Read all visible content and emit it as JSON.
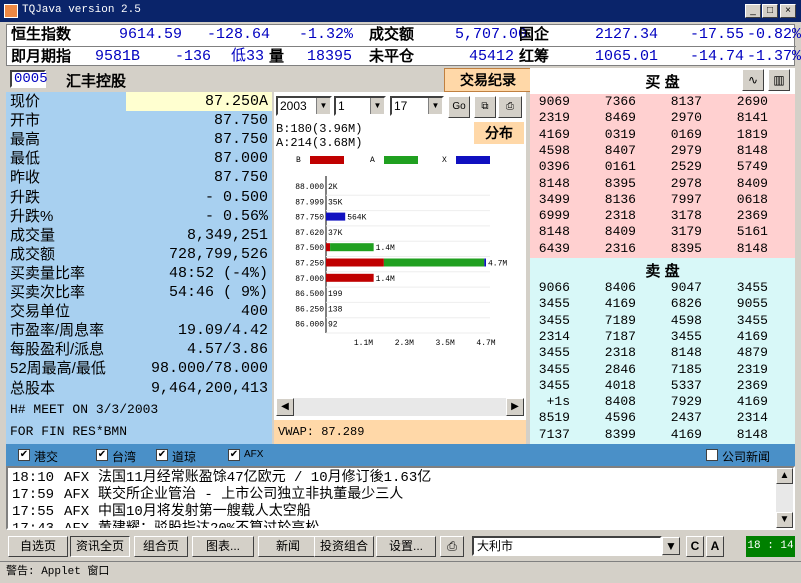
{
  "window": {
    "title": "TQJava version 2.5",
    "min": "_",
    "max": "□",
    "close": "×"
  },
  "indices": [
    {
      "name": "恒生指数",
      "v1": "9614.59",
      "v2": "-128.64",
      "v3": "-1.32%",
      "name2": "成交额",
      "v4": "5,707.00",
      "name3": "国企",
      "v5": "2127.34",
      "v6": "-17.55",
      "v7": "-0.82%"
    },
    {
      "name": "即月期指",
      "v1": "9581B",
      "v2": "-136",
      "v3": "低33",
      "name2": "量",
      "v3b": "18395",
      "name2b": "未平仓",
      "v4": "45412",
      "name3": "红筹",
      "v5": "1065.01",
      "v6": "-14.74",
      "v7": "-1.37%"
    }
  ],
  "stock": {
    "code": "0005",
    "name": "汇丰控股",
    "trade_btn": "交易纪录"
  },
  "quote": [
    {
      "label": "现价",
      "value": "87.250A"
    },
    {
      "label": "开市",
      "value": "87.750"
    },
    {
      "label": "最高",
      "value": "87.750"
    },
    {
      "label": "最低",
      "value": "87.000"
    },
    {
      "label": "昨收",
      "value": "87.750"
    },
    {
      "label": "升跌",
      "value": "-  0.500"
    },
    {
      "label": "升跌%",
      "value": "-  0.56%"
    },
    {
      "label": "成交量",
      "value": "8,349,251"
    },
    {
      "label": "成交额",
      "value": "728,799,526"
    },
    {
      "label": "买卖量比率",
      "value": "48:52 (-4%)"
    },
    {
      "label": "买卖次比率",
      "value": "54:46 ( 9%)"
    },
    {
      "label": "交易单位",
      "value": "400"
    },
    {
      "label": "市盈率/周息率",
      "value": "19.09/4.42"
    },
    {
      "label": "每股盈利/派息",
      "value": "4.57/3.86"
    },
    {
      "label": "52周最高/最低",
      "value": "98.000/78.000"
    },
    {
      "label": "总股本",
      "value": "9,464,200,413"
    }
  ],
  "ticker": [
    "H# MEET ON 3/3/2003",
    "FOR FIN RES*BMN"
  ],
  "chart_panel": {
    "year": "2003",
    "month": "1",
    "day": "17",
    "go": "Go",
    "ba_info": "B:180(3.96M) A:214(3.68M)",
    "dist_btn": "分布",
    "vwap": "VWAP:  87.289"
  },
  "chart_data": {
    "type": "bar",
    "legend": [
      "B",
      "A",
      "X"
    ],
    "colors": {
      "B": "#c00000",
      "A": "#20a020",
      "X": "#1010c0"
    },
    "categories": [
      "88.000",
      "87.999",
      "87.750",
      "87.620",
      "87.500",
      "87.250",
      "87.000",
      "86.500",
      "86.250",
      "86.000"
    ],
    "labels": [
      "2K",
      "35K",
      "564K",
      "37K",
      "1.4M",
      "4.7M",
      "1.4M",
      "199",
      "138",
      "92"
    ],
    "series": [
      {
        "name": "B",
        "values": [
          0,
          0,
          0,
          0,
          0.12,
          1.7,
          1.4,
          0,
          0,
          0
        ]
      },
      {
        "name": "A",
        "values": [
          0,
          0,
          0,
          0,
          1.28,
          2.95,
          0,
          0,
          0,
          0
        ]
      },
      {
        "name": "X",
        "values": [
          0,
          0,
          0.564,
          0,
          0,
          0.05,
          0,
          0,
          0,
          0
        ]
      }
    ],
    "xticks": [
      "1.1M",
      "2.3M",
      "3.5M",
      "4.7M"
    ],
    "xlim": [
      0,
      4.7
    ]
  },
  "bid": {
    "title": "买  盘",
    "rows": [
      [
        "9069",
        "7366",
        "8137",
        "2690"
      ],
      [
        "2319",
        "8469",
        "2970",
        "8141"
      ],
      [
        "4169",
        "0319",
        "0169",
        "1819"
      ],
      [
        "4598",
        "8407",
        "2979",
        "8148"
      ],
      [
        "0396",
        "0161",
        "2529",
        "5749"
      ],
      [
        "8148",
        "8395",
        "2978",
        "8409"
      ],
      [
        "3499",
        "8136",
        "7997",
        "0618"
      ],
      [
        "6999",
        "2318",
        "3178",
        "2369"
      ],
      [
        "8148",
        "8409",
        "3179",
        "5161"
      ],
      [
        "6439",
        "2316",
        "8395",
        "8148"
      ]
    ]
  },
  "ask": {
    "title": "卖  盘",
    "rows": [
      [
        "9066",
        "8406",
        "9047",
        "3455"
      ],
      [
        "3455",
        "4169",
        "6826",
        "9055"
      ],
      [
        "3455",
        "7189",
        "4598",
        "3455"
      ],
      [
        "2314",
        "7187",
        "3455",
        "4169"
      ],
      [
        "3455",
        "2318",
        "8148",
        "4879"
      ],
      [
        "3455",
        "2846",
        "7185",
        "2319"
      ],
      [
        "3455",
        "4018",
        "5337",
        "2369"
      ],
      [
        "+1s",
        "8408",
        "7929",
        "4169"
      ],
      [
        "8519",
        "4596",
        "2437",
        "2314"
      ],
      [
        "7137",
        "8399",
        "4169",
        "8148"
      ]
    ]
  },
  "filters": {
    "items": [
      "港交",
      "台湾",
      "道琼",
      "AFX"
    ],
    "company_news": "公司新闻"
  },
  "news": [
    {
      "time": "18:10",
      "src": "AFX",
      "text": "法国11月经常账盈馀47亿欧元 / 10月修订後1.63亿"
    },
    {
      "time": "17:59",
      "src": "AFX",
      "text": "联交所企业管治 - 上市公司独立非执董最少三人"
    },
    {
      "time": "17:55",
      "src": "AFX",
      "text": "中国10月将发射第一艘载人太空船"
    },
    {
      "time": "17:43",
      "src": "AFX",
      "text": "黄建耀：驳股指达20%不算过於高松"
    }
  ],
  "toolbar": {
    "buttons": [
      "自选页",
      "资讯全页",
      "组合页",
      "图表...",
      "新闻",
      "投资组合",
      "设置..."
    ],
    "search_value": "大利市",
    "c": "C",
    "a": "A",
    "clock": "18 : 14"
  },
  "status": "警告: Applet 窗口"
}
